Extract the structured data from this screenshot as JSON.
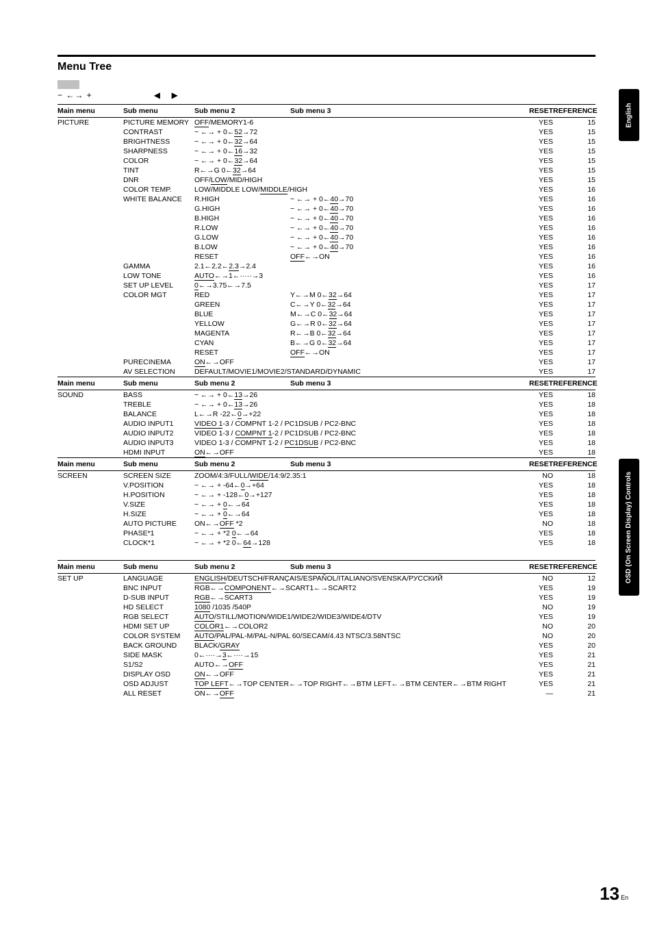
{
  "header": {
    "title": "Menu Tree",
    "legend1": "−  ←→ +",
    "legend_tri_left": "◀",
    "legend_tri_right": "▶"
  },
  "cols": {
    "main": "Main menu",
    "sub": "Sub menu",
    "sub2": "Sub menu 2",
    "sub3": "Sub menu 3",
    "reset": "RESET",
    "ref": "REFERENCE"
  },
  "sections": [
    {
      "rows": [
        {
          "main": "PICTURE",
          "sub": "PICTURE MEMORY",
          "s2a": "",
          "s2hl": "OFF",
          "s2b": "/MEMORY1-6",
          "s3a": "",
          "s3hl": "",
          "s3b": "",
          "reset": "YES",
          "ref": "15"
        },
        {
          "main": "",
          "sub": "CONTRAST",
          "s2a": "− ←→ +   0←",
          "s2hl": "52",
          "s2b": "→72",
          "reset": "YES",
          "ref": "15"
        },
        {
          "main": "",
          "sub": "BRIGHTNESS",
          "s2a": "− ←→ +   0←",
          "s2hl": "32",
          "s2b": "→64",
          "reset": "YES",
          "ref": "15"
        },
        {
          "main": "",
          "sub": "SHARPNESS",
          "s2a": "− ←→ +   0←",
          "s2hl": "16",
          "s2b": "→32",
          "reset": "YES",
          "ref": "15"
        },
        {
          "main": "",
          "sub": "COLOR",
          "s2a": "− ←→ +   0←",
          "s2hl": "32",
          "s2b": "→64",
          "reset": "YES",
          "ref": "15"
        },
        {
          "main": "",
          "sub": "TINT",
          "s2a": "R←→G    0←",
          "s2hl": "32",
          "s2b": "→64",
          "reset": "YES",
          "ref": "15"
        },
        {
          "main": "",
          "sub": "DNR",
          "s2a": "OFF/",
          "s2hl": "LOW",
          "s2b": "/MID/HIGH",
          "reset": "YES",
          "ref": "15"
        },
        {
          "main": "",
          "sub": "COLOR TEMP.",
          "s2a": "LOW/MIDDLE LOW/",
          "s2hl": "MIDDLE",
          "s2b": "/HIGH",
          "reset": "YES",
          "ref": "16"
        },
        {
          "main": "",
          "sub": "WHITE BALANCE",
          "s2a": "R.HIGH",
          "s3a": "− ←→ +   0←",
          "s3hl": "40",
          "s3b": "→70",
          "reset": "YES",
          "ref": "16"
        },
        {
          "main": "",
          "sub": "",
          "s2a": "G.HIGH",
          "s3a": "− ←→ +   0←",
          "s3hl": "40",
          "s3b": "→70",
          "reset": "YES",
          "ref": "16"
        },
        {
          "main": "",
          "sub": "",
          "s2a": "B.HIGH",
          "s3a": "− ←→ +   0←",
          "s3hl": "40",
          "s3b": "→70",
          "reset": "YES",
          "ref": "16"
        },
        {
          "main": "",
          "sub": "",
          "s2a": "R.LOW",
          "s3a": "− ←→ +   0←",
          "s3hl": "40",
          "s3b": "→70",
          "reset": "YES",
          "ref": "16"
        },
        {
          "main": "",
          "sub": "",
          "s2a": "G.LOW",
          "s3a": "− ←→ +   0←",
          "s3hl": "40",
          "s3b": "→70",
          "reset": "YES",
          "ref": "16"
        },
        {
          "main": "",
          "sub": "",
          "s2a": "B.LOW",
          "s3a": "− ←→ +   0←",
          "s3hl": "40",
          "s3b": "→70",
          "reset": "YES",
          "ref": "16"
        },
        {
          "main": "",
          "sub": "",
          "s2a": "RESET",
          "s3a": "",
          "s3hl": "OFF",
          "s3b": "←→ON",
          "reset": "YES",
          "ref": "16"
        },
        {
          "main": "",
          "sub": "GAMMA",
          "s2a": "2.1←2.2←",
          "s2hl": "2.3",
          "s2b": "→2.4",
          "reset": "YES",
          "ref": "16"
        },
        {
          "main": "",
          "sub": "LOW TONE",
          "s2a": "",
          "s2hl": "AUTO",
          "s2b": "←→1←·····→3",
          "reset": "YES",
          "ref": "16"
        },
        {
          "main": "",
          "sub": "SET UP LEVEL",
          "s2a": "",
          "s2hl": "0",
          "s2b": "←→3.75←→7.5",
          "reset": "YES",
          "ref": "17"
        },
        {
          "main": "",
          "sub": "COLOR MGT",
          "s2a": "RED",
          "s3a": "Y←→M   0←",
          "s3hl": "32",
          "s3b": "→64",
          "reset": "YES",
          "ref": "17"
        },
        {
          "main": "",
          "sub": "",
          "s2a": "GREEN",
          "s3a": "C←→Y   0←",
          "s3hl": "32",
          "s3b": "→64",
          "reset": "YES",
          "ref": "17"
        },
        {
          "main": "",
          "sub": "",
          "s2a": "BLUE",
          "s3a": "M←→C   0←",
          "s3hl": "32",
          "s3b": "→64",
          "reset": "YES",
          "ref": "17"
        },
        {
          "main": "",
          "sub": "",
          "s2a": "YELLOW",
          "s3a": "G←→R   0←",
          "s3hl": "32",
          "s3b": "→64",
          "reset": "YES",
          "ref": "17"
        },
        {
          "main": "",
          "sub": "",
          "s2a": "MAGENTA",
          "s3a": "R←→B   0←",
          "s3hl": "32",
          "s3b": "→64",
          "reset": "YES",
          "ref": "17"
        },
        {
          "main": "",
          "sub": "",
          "s2a": "CYAN",
          "s3a": "B←→G   0←",
          "s3hl": "32",
          "s3b": "→64",
          "reset": "YES",
          "ref": "17"
        },
        {
          "main": "",
          "sub": "",
          "s2a": "RESET",
          "s3a": "",
          "s3hl": "OFF",
          "s3b": "←→ON",
          "reset": "YES",
          "ref": "17"
        },
        {
          "main": "",
          "sub": "PURECINEMA",
          "s2a": "",
          "s2hl": "ON",
          "s2b": "←→OFF",
          "reset": "YES",
          "ref": "17"
        },
        {
          "main": "",
          "sub": "AV SELECTION",
          "s2a": "DEFAULT/MOVIE1/MOVIE2/STANDARD/DYNAMIC",
          "reset": "YES",
          "ref": "17"
        }
      ]
    },
    {
      "rows": [
        {
          "main": "SOUND",
          "sub": "BASS",
          "s2a": "− ←→ +   0←",
          "s2hl": "13",
          "s2b": "→26",
          "reset": "YES",
          "ref": "18"
        },
        {
          "main": "",
          "sub": "TREBLE",
          "s2a": "− ←→ +   0←",
          "s2hl": "13",
          "s2b": "→26",
          "reset": "YES",
          "ref": "18"
        },
        {
          "main": "",
          "sub": "BALANCE",
          "s2a": "L←→R    -22←",
          "s2hl": "0",
          "s2b": "→+22",
          "reset": "YES",
          "ref": "18"
        },
        {
          "main": "",
          "sub": "AUDIO INPUT1",
          "s2a": "",
          "s2hl": "VIDEO 1",
          "s2b": "-3 / COMPNT 1-2 / PC1DSUB / PC2-BNC",
          "reset": "YES",
          "ref": "18"
        },
        {
          "main": "",
          "sub": "AUDIO INPUT2",
          "s2a": "VIDEO 1-3 / ",
          "s2hl": "COMPNT 1",
          "s2b": "-2 / PC1DSUB / PC2-BNC",
          "reset": "YES",
          "ref": "18"
        },
        {
          "main": "",
          "sub": "AUDIO INPUT3",
          "s2a": "VIDEO 1-3 / COMPNT 1-2 / ",
          "s2hl": "PC1DSUB",
          "s2b": " / PC2-BNC",
          "reset": "YES",
          "ref": "18"
        },
        {
          "main": "",
          "sub": "HDMI INPUT",
          "s2a": "",
          "s2hl": "ON",
          "s2b": "←→OFF",
          "reset": "YES",
          "ref": "18"
        }
      ]
    },
    {
      "rows": [
        {
          "main": "SCREEN",
          "sub": "SCREEN SIZE",
          "s2a": "ZOOM/4:3/FULL/",
          "s2hl": "WIDE",
          "s2b": "/14:9/2.35:1",
          "reset": "NO",
          "ref": "18"
        },
        {
          "main": "",
          "sub": "V.POSITION",
          "s2a": "− ←→ +   -64←",
          "s2hl": "0",
          "s2b": "→+64",
          "reset": "YES",
          "ref": "18"
        },
        {
          "main": "",
          "sub": "H.POSITION",
          "s2a": "− ←→ +   -128←",
          "s2hl": "0",
          "s2b": "→+127",
          "reset": "YES",
          "ref": "18"
        },
        {
          "main": "",
          "sub": "V.SIZE",
          "s2a": "− ←→ +   ",
          "s2hl": "0",
          "s2b": "←→64",
          "reset": "YES",
          "ref": "18"
        },
        {
          "main": "",
          "sub": "H.SIZE",
          "s2a": "− ←→ +   ",
          "s2hl": "0",
          "s2b": "←→64",
          "reset": "YES",
          "ref": "18"
        },
        {
          "main": "",
          "sub": "AUTO PICTURE",
          "s2a": "ON←→",
          "s2hl": "OFF",
          "s2b": " *2",
          "reset": "NO",
          "ref": "18"
        },
        {
          "main": "",
          "sub": "PHASE*1",
          "s2a": "− ←→ + *2  ",
          "s2hl": "0",
          "s2b": "←→64",
          "reset": "YES",
          "ref": "18"
        },
        {
          "main": "",
          "sub": "CLOCK*1",
          "s2a": "− ←→ + *2  0←",
          "s2hl": "64",
          "s2b": "→128",
          "reset": "YES",
          "ref": "18"
        }
      ]
    },
    {
      "spacer": true,
      "rows": [
        {
          "main": "SET UP",
          "sub": "LANGUAGE",
          "s2a": "",
          "s2hl": "ENGLISH",
          "s2b": "/DEUTSCH/FRANÇAIS/ESPAÑOL/ITALIANO/SVENSKA/РУССКИЙ",
          "reset": "NO",
          "ref": "12"
        },
        {
          "main": "",
          "sub": "BNC INPUT",
          "s2a": "RGB←→",
          "s2hl": "COMPONENT",
          "s2b": "←→SCART1←→SCART2",
          "reset": "YES",
          "ref": "19"
        },
        {
          "main": "",
          "sub": "D-SUB INPUT",
          "s2a": "",
          "s2hl": "RGB",
          "s2b": "←→SCART3",
          "reset": "YES",
          "ref": "19"
        },
        {
          "main": "",
          "sub": "HD SELECT",
          "s2a": "",
          "s2hl": "1080",
          "s2b": " /1035 /540P",
          "reset": "NO",
          "ref": "19"
        },
        {
          "main": "",
          "sub": "RGB SELECT",
          "s2a": "",
          "s2hl": "AUTO",
          "s2b": "/STILL/MOTION/WIDE1/WIDE2/WIDE3/WIDE4/DTV",
          "reset": "YES",
          "ref": "19"
        },
        {
          "main": "",
          "sub": "HDMI SET UP",
          "s2a": "",
          "s2hl": "COLOR1",
          "s2b": "←→COLOR2",
          "reset": "NO",
          "ref": "20"
        },
        {
          "main": "",
          "sub": "COLOR SYSTEM",
          "s2a": "",
          "s2hl": "AUTO",
          "s2b": "/PAL/PAL-M/PAL-N/PAL 60/SECAM/4.43 NTSC/3.58NTSC",
          "reset": "NO",
          "ref": "20"
        },
        {
          "main": "",
          "sub": "BACK GROUND",
          "s2a": "BLACK/",
          "s2hl": "GRAY",
          "s2b": "",
          "reset": "YES",
          "ref": "20"
        },
        {
          "main": "",
          "sub": "SIDE MASK",
          "s2a": "0←····→",
          "s2hl": "3",
          "s2b": "←····→15",
          "reset": "YES",
          "ref": "21"
        },
        {
          "main": "",
          "sub": "S1/S2",
          "s2a": "AUTO←→",
          "s2hl": "OFF",
          "s2b": "",
          "reset": "YES",
          "ref": "21"
        },
        {
          "main": "",
          "sub": "DISPLAY OSD",
          "s2a": "",
          "s2hl": "ON",
          "s2b": "←→OFF",
          "reset": "YES",
          "ref": "21"
        },
        {
          "main": "",
          "sub": "OSD ADJUST",
          "s2a": "",
          "s2hl": "TOP LEFT",
          "s2b": "←→TOP CENTER←→TOP RIGHT←→BTM LEFT←→BTM CENTER←→BTM RIGHT",
          "reset": "YES",
          "ref": "21"
        },
        {
          "main": "",
          "sub": "ALL RESET",
          "s2a": "ON←→",
          "s2hl": "OFF",
          "s2b": "",
          "reset": "—",
          "ref": "21"
        }
      ]
    }
  ],
  "tabs": {
    "eng": "English",
    "osd": "OSD (On Screen Display) Controls"
  },
  "page": {
    "num": "13",
    "suffix": "En"
  }
}
